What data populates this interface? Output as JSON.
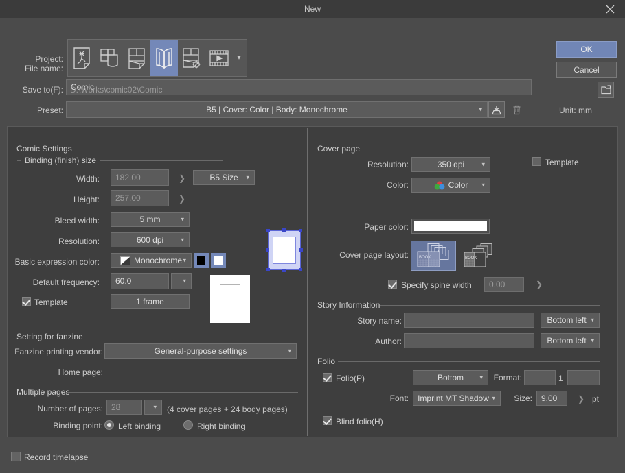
{
  "window": {
    "title": "New",
    "close_icon": "close-icon"
  },
  "actions": {
    "ok": "OK",
    "cancel": "Cancel"
  },
  "top": {
    "project_label": "Project:",
    "project_icons": [
      "illustration-icon",
      "webtoon-icon",
      "comic-page-icon",
      "comic-book-icon",
      "all-comic-settings-icon",
      "animation-icon"
    ],
    "project_selected_index": 3,
    "project_more_icon": "chevron-down-icon",
    "file_name_label": "File name:",
    "file_name_value": "Comic",
    "save_to_label": "Save to(F):",
    "save_to_value": "D:\\Works\\comic02\\Comic",
    "folder_icon": "folder-open-icon",
    "preset_label": "Preset:",
    "preset_value": "B5 | Cover: Color | Body: Monochrome",
    "preset_save_icon": "save-preset-icon",
    "preset_delete_icon": "trash-icon",
    "unit_text": "Unit: mm"
  },
  "comic_settings": {
    "title": "Comic Settings",
    "binding": {
      "title": "Binding (finish) size",
      "width_label": "Width:",
      "width_value": "182.00",
      "height_label": "Height:",
      "height_value": "257.00",
      "size_preset": "B5 Size",
      "bleed_label": "Bleed width:",
      "bleed_value": "5 mm",
      "resolution_label": "Resolution:",
      "resolution_value": "600 dpi",
      "expression_label": "Basic expression color:",
      "expression_value": "Monochrome",
      "expression_icon": "monochrome-gradient-icon",
      "swatch_black": "#000000",
      "swatch_white": "#ffffff",
      "frequency_label": "Default frequency:",
      "frequency_value": "60.0",
      "template_label": "Template",
      "template_checked": true,
      "template_value": "1 frame"
    },
    "fanzine": {
      "title": "Setting for fanzine",
      "vendor_label": "Fanzine printing vendor:",
      "vendor_value": "General-purpose settings",
      "home_page_label": "Home page:",
      "home_page_value": ""
    },
    "multiple_pages": {
      "title": "Multiple pages",
      "pages_label": "Number of pages:",
      "pages_value": "28",
      "pages_note": "(4 cover pages + 24 body pages)",
      "binding_point_label": "Binding point:",
      "left_binding_label": "Left binding",
      "right_binding_label": "Right binding",
      "binding_selected": "left"
    }
  },
  "cover_page": {
    "title": "Cover page",
    "resolution_label": "Resolution:",
    "resolution_value": "350 dpi",
    "color_label": "Color:",
    "color_value": "Color",
    "color_icon": "rgb-circles-icon",
    "template_label": "Template",
    "template_checked": false,
    "paper_color_label": "Paper color:",
    "paper_color_value": "#ffffff",
    "layout_label": "Cover page layout:",
    "layout_options": [
      "spread-cover-icon",
      "separate-cover-icon"
    ],
    "layout_selected_index": 0,
    "spine_label": "Specify spine width",
    "spine_checked": true,
    "spine_value": "0.00"
  },
  "story_information": {
    "title": "Story Information",
    "story_name_label": "Story name:",
    "story_name_value": "",
    "story_name_position": "Bottom left",
    "author_label": "Author:",
    "author_value": "",
    "author_position": "Bottom left"
  },
  "folio": {
    "title": "Folio",
    "folio_label": "Folio(P)",
    "folio_checked": true,
    "position_value": "Bottom",
    "format_label": "Format:",
    "format_prefix": "",
    "format_number": "1",
    "format_suffix": "",
    "font_label": "Font:",
    "font_value": "Imprint MT Shadow",
    "size_label": "Size:",
    "size_value": "9.00",
    "size_unit": "pt",
    "blind_folio_label": "Blind folio(H)",
    "blind_folio_checked": true
  },
  "footer": {
    "record_timelapse_label": "Record timelapse",
    "record_timelapse_checked": false
  }
}
